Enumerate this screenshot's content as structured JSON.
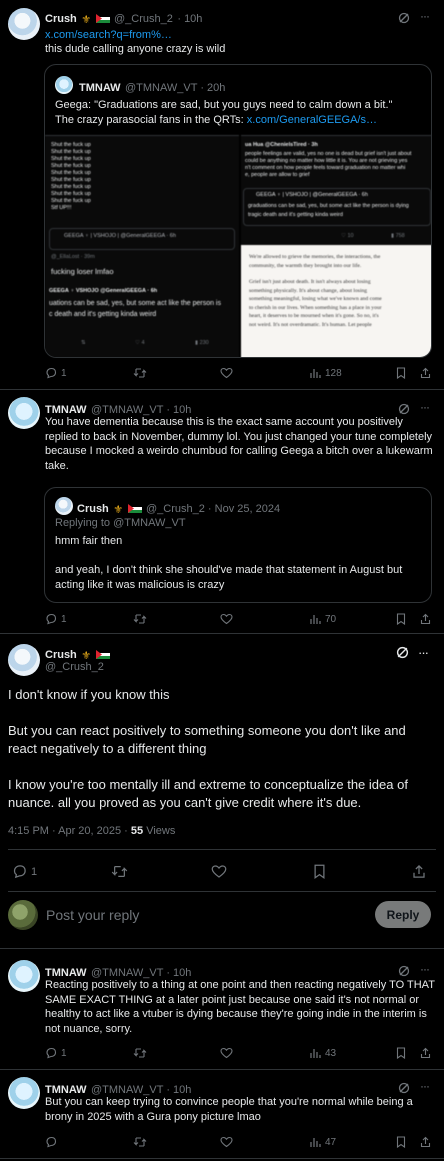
{
  "post1": {
    "name": "Crush",
    "handle": "@_Crush_2",
    "time": "· 10h",
    "link": "x.com/search?q=from%…",
    "text": "this dude calling anyone crazy is wild",
    "quote": {
      "name": "TMNAW",
      "handle": "@TMNAW_VT · 20h",
      "text1": "Geega: \"Graduations are sad, but you guys need to calm down a bit.\"",
      "text2": "The crazy parasocial fans in the QRTs: ",
      "link": "x.com/GeneralGEEGA/s…",
      "img_left": {
        "lines": [
          "Shut the fuck up",
          "Shut the fuck up",
          "Shut the fuck up",
          "Shut the fuck up",
          "Shut the fuck up",
          "Shut the fuck up",
          "Shut the fuck up",
          "Shut the fuck up",
          "Shut the fuck up",
          "Stf UP!!!"
        ],
        "tag": "GEEGA ♀ | VSHOJO | @GeneralGEEGA · 6h",
        "user": "@_EllaLost · 39m",
        "line": "fucking loser lmfao",
        "tweet_head": "GEEGA ♀ VSHOJO @GeneralGEEGA · 6h",
        "tweet1": "uations can be sad, yes, but some act like the person is",
        "tweet2": "c death and it's getting kinda weird",
        "stat1": "4",
        "stat2": "230"
      },
      "img_right": {
        "head": "ua Hua @ChenieIsTired · 3h",
        "l1": "people feelings are valid, yes no one is dead but grief isn't just about",
        "l2": "could be anything no matter how little it is. You are not grieving yes",
        "l3": "n't comment on how people feels toward graduation no matter whi",
        "l4": "e, people are allow to grief",
        "tweet_head": "GEEGA ♀ | VSHOJO | @GeneralGEEGA · 6h",
        "t1": "graduations can be sad, yes, but some act like the person is dying",
        "t2": "tragic death and it's getting kinda weird",
        "s1": "10",
        "s2": "758",
        "p1": "We're allowed to grieve the memories, the interactions, the",
        "p2": "community, the warmth they brought into our life.",
        "p3": "Grief isn't just about death. It isn't always about losing",
        "p4": "something physically. It's about change, about losing",
        "p5": "something meaningful, losing what we've known and come",
        "p6": "to cherish in our lives. When something has a place in your",
        "p7": "heart, it deserves to be mourned when it's gone. So no, it's",
        "p8": "not weird. It's not overdramatic. It's human. Let people"
      }
    },
    "replies": "1",
    "views": "128"
  },
  "post2": {
    "name": "TMNAW",
    "handle": "@TMNAW_VT · 10h",
    "text": "You have dementia because this is the exact same account you positively replied to back in November, dummy lol. You just changed your tune completely because I mocked a weirdo chumbud for calling Geega a bitch over a lukewarm take.",
    "quote": {
      "name": "Crush",
      "handle": "@_Crush_2 · Nov 25, 2024",
      "replying": "Replying to @TMNAW_VT",
      "text1": "hmm fair then",
      "text2": "and yeah, I don't think she should've made that statement in August but acting like it was malicious is crazy"
    },
    "replies": "1",
    "views": "70"
  },
  "main": {
    "name": "Crush",
    "handle": "@_Crush_2",
    "p1": "I don't know if you know this",
    "p2": "But you can react positively to something someone you don't like and react negatively to a different thing",
    "p3": "I know you're too mentally ill and extreme to conceptualize the idea of nuance. all you proved as you can't give credit where it's due.",
    "timestamp": "4:15 PM · Apr 20, 2025 · ",
    "views_count": "55",
    "views_label": " Views",
    "replies": "1"
  },
  "compose": {
    "placeholder": "Post your reply",
    "button": "Reply"
  },
  "post3": {
    "name": "TMNAW",
    "handle": "@TMNAW_VT · 10h",
    "text": "Reacting positively to a thing at one point and then reacting negatively TO THAT SAME EXACT THING at a later point just because one said it's not normal or healthy to act like a vtuber is dying because they're going indie in the interim is not nuance, sorry.",
    "replies": "1",
    "views": "43"
  },
  "post4": {
    "name": "TMNAW",
    "handle": "@TMNAW_VT · 10h",
    "text": "But you can keep trying to convince people that you're normal while being a brony in 2025 with a Gura pony picture lmao",
    "views": "47"
  },
  "colors": {
    "background": "#000000",
    "text": "#e7e9ea",
    "muted": "#71767b",
    "link": "#1d9bf0",
    "border": "#2f3336"
  }
}
